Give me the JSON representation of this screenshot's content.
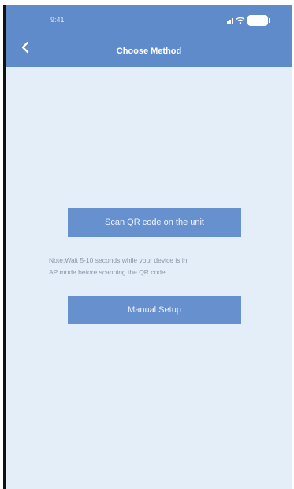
{
  "status_bar": {
    "time": "9:41"
  },
  "header": {
    "title": "Choose Method",
    "back_icon": "chevron-left-icon"
  },
  "main": {
    "scan_button_label": "Scan QR code on the unit",
    "note_line1": "Note:Wait 5-10 seconds while your device is in",
    "note_line2": "AP mode before scanning the QR code.",
    "manual_button_label": "Manual Setup"
  },
  "colors": {
    "header_bg": "#5f8bcb",
    "screen_bg": "#e4eef9",
    "button_bg": "#6790cf",
    "note_text": "#8b97a8",
    "frame": "#111111"
  }
}
